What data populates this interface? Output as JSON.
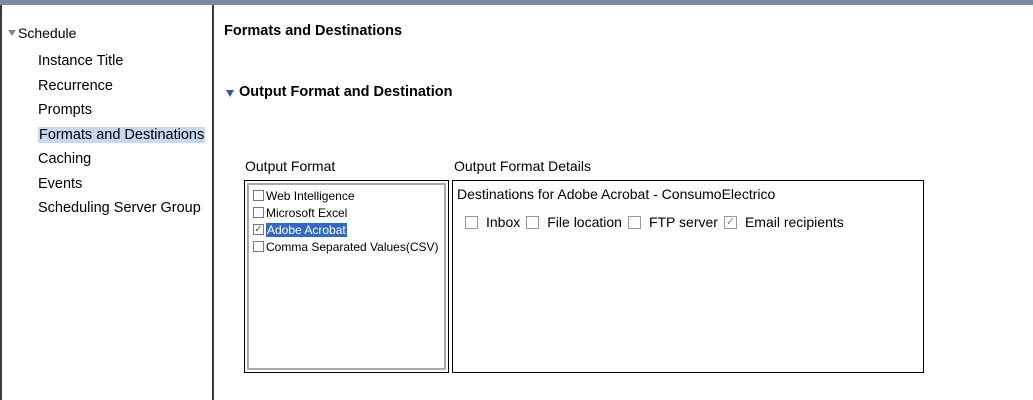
{
  "sidebar": {
    "root_label": "Schedule",
    "items": [
      {
        "label": "Instance Title",
        "selected": false
      },
      {
        "label": "Recurrence",
        "selected": false
      },
      {
        "label": "Prompts",
        "selected": false
      },
      {
        "label": "Formats and Destinations",
        "selected": true
      },
      {
        "label": "Caching",
        "selected": false
      },
      {
        "label": "Events",
        "selected": false
      },
      {
        "label": "Scheduling Server Group",
        "selected": false
      }
    ]
  },
  "main": {
    "title": "Formats and Destinations",
    "section_title": "Output Format and Destination",
    "output_format_label": "Output Format",
    "output_format_details_label": "Output Format Details",
    "formats": [
      {
        "label": "Web Intelligence",
        "checked": false,
        "selected": false
      },
      {
        "label": "Microsoft Excel",
        "checked": false,
        "selected": false
      },
      {
        "label": "Adobe Acrobat",
        "checked": true,
        "selected": true
      },
      {
        "label": "Comma Separated Values(CSV)",
        "checked": false,
        "selected": false
      }
    ],
    "details": {
      "title": "Destinations for Adobe Acrobat - ConsumoElectrico",
      "destinations": [
        {
          "label": "Inbox",
          "checked": false
        },
        {
          "label": "File location",
          "checked": false
        },
        {
          "label": "FTP server",
          "checked": false
        },
        {
          "label": "Email recipients",
          "checked": true
        }
      ]
    }
  },
  "colors": {
    "selection_highlight": "#c5d9f1",
    "list_selection": "#3169c6",
    "section_triangle": "#2c5aa0"
  }
}
